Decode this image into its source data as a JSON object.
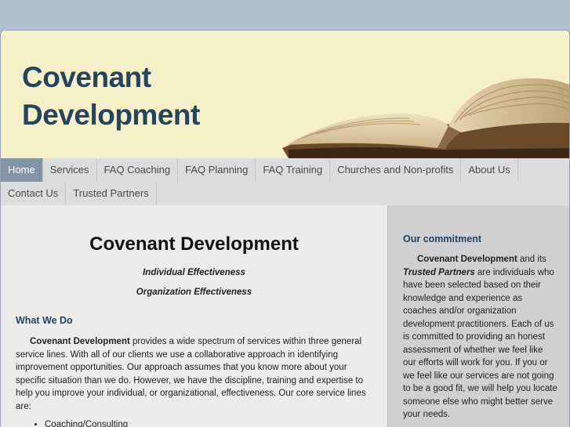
{
  "header": {
    "title_line1": "Covenant",
    "title_line2": "Development"
  },
  "nav": {
    "row1": [
      "Home",
      "Services",
      "FAQ Coaching",
      "FAQ Planning",
      "FAQ Training",
      "Churches and Non-profits",
      "About Us"
    ],
    "row2": [
      "Contact Us",
      "Trusted Partners"
    ],
    "active": "Home"
  },
  "main": {
    "title": "Covenant Development",
    "tagline1": "Individual Effectiveness",
    "tagline2": "Organization Effectiveness",
    "section_heading": "What We Do",
    "intro_bold": "Covenant Development",
    "intro_text": " provides a wide spectrum of services within three general service lines.  With all of our clients we use a collaborative approach in identifying improvement opportunities.  Our approach assumes that you know more about your specific situation than we do.  However, we have the discipline, training and expertise to help you improve your individual, or organizational, effectiveness.  Our core service lines are:",
    "services": [
      "Coaching/Consulting"
    ]
  },
  "sidebar": {
    "heading": "Our commitment",
    "bold1": "Covenant Development",
    "text1": " and its ",
    "bold2": "Trusted Partners",
    "text2": " are individuals who have been selected based on their knowledge and experience as coaches and/or organization development practitioners.  Each of us is committed to providing an honest assessment of whether we feel like our efforts will work for you.  If you or we feel like our services are not going to be a good fit, we will help you locate someone else who might better serve your needs."
  }
}
